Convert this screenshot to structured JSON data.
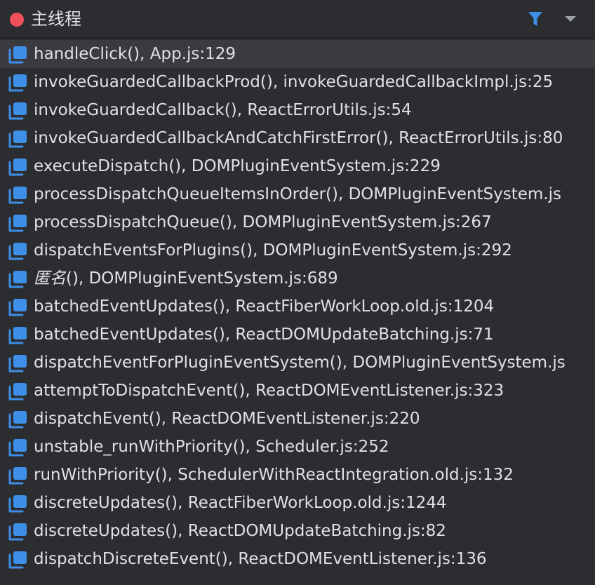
{
  "header": {
    "status_color": "#f0505a",
    "title": "主线程",
    "filter_icon": "filter-icon",
    "filter_color": "#3d8fe8",
    "dropdown_icon": "chevron-down-icon"
  },
  "frames": [
    {
      "method": "handleClick()",
      "location": ", App.js:129",
      "selected": true,
      "italic": false
    },
    {
      "method": "invokeGuardedCallbackProd()",
      "location": ", invokeGuardedCallbackImpl.js:25",
      "selected": false,
      "italic": false
    },
    {
      "method": "invokeGuardedCallback()",
      "location": ", ReactErrorUtils.js:54",
      "selected": false,
      "italic": false
    },
    {
      "method": "invokeGuardedCallbackAndCatchFirstError()",
      "location": ", ReactErrorUtils.js:80",
      "selected": false,
      "italic": false
    },
    {
      "method": "executeDispatch()",
      "location": ", DOMPluginEventSystem.js:229",
      "selected": false,
      "italic": false
    },
    {
      "method": "processDispatchQueueItemsInOrder()",
      "location": ", DOMPluginEventSystem.js",
      "selected": false,
      "italic": false
    },
    {
      "method": "processDispatchQueue()",
      "location": ", DOMPluginEventSystem.js:267",
      "selected": false,
      "italic": false
    },
    {
      "method": "dispatchEventsForPlugins()",
      "location": ", DOMPluginEventSystem.js:292",
      "selected": false,
      "italic": false
    },
    {
      "method": "匿名",
      "location": "(), DOMPluginEventSystem.js:689",
      "selected": false,
      "italic": true
    },
    {
      "method": "batchedEventUpdates()",
      "location": ", ReactFiberWorkLoop.old.js:1204",
      "selected": false,
      "italic": false
    },
    {
      "method": "batchedEventUpdates()",
      "location": ", ReactDOMUpdateBatching.js:71",
      "selected": false,
      "italic": false
    },
    {
      "method": "dispatchEventForPluginEventSystem()",
      "location": ", DOMPluginEventSystem.js",
      "selected": false,
      "italic": false
    },
    {
      "method": "attemptToDispatchEvent()",
      "location": ", ReactDOMEventListener.js:323",
      "selected": false,
      "italic": false
    },
    {
      "method": "dispatchEvent()",
      "location": ", ReactDOMEventListener.js:220",
      "selected": false,
      "italic": false
    },
    {
      "method": "unstable_runWithPriority()",
      "location": ", Scheduler.js:252",
      "selected": false,
      "italic": false
    },
    {
      "method": "runWithPriority()",
      "location": ", SchedulerWithReactIntegration.old.js:132",
      "selected": false,
      "italic": false
    },
    {
      "method": "discreteUpdates()",
      "location": ", ReactFiberWorkLoop.old.js:1244",
      "selected": false,
      "italic": false
    },
    {
      "method": "discreteUpdates()",
      "location": ", ReactDOMUpdateBatching.js:82",
      "selected": false,
      "italic": false
    },
    {
      "method": "dispatchDiscreteEvent()",
      "location": ", ReactDOMEventListener.js:136",
      "selected": false,
      "italic": false
    }
  ],
  "frame_icon": "stack-frame-icon",
  "frame_icon_color": "#3d8fe8"
}
